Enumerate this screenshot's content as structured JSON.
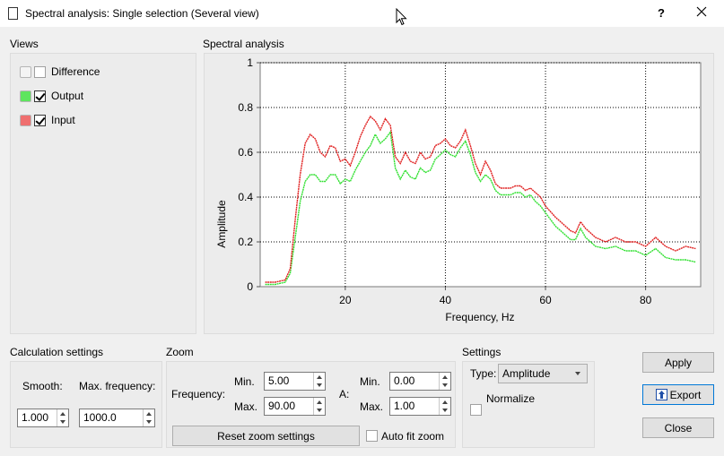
{
  "window": {
    "title": "Spectral analysis: Single selection (Several view)",
    "help": "?",
    "close": "✕"
  },
  "views": {
    "label": "Views",
    "items": [
      {
        "label": "Difference",
        "checked": false,
        "color": "#f4f4f4"
      },
      {
        "label": "Output",
        "checked": true,
        "color": "#5ee55e"
      },
      {
        "label": "Input",
        "checked": true,
        "color": "#ef6f6f"
      }
    ]
  },
  "chart_group_label": "Spectral analysis",
  "chart_data": {
    "type": "line",
    "xlabel": "Frequency, Hz",
    "ylabel": "Amplitude",
    "xlim": [
      3,
      91
    ],
    "ylim": [
      0,
      1
    ],
    "xticks": [
      "20",
      "40",
      "60",
      "80"
    ],
    "yticks": [
      "0",
      "0.2",
      "0.4",
      "0.6",
      "0.8",
      "1"
    ],
    "grid": true,
    "series": [
      {
        "color": "#e02020",
        "x": [
          4,
          6,
          8,
          9,
          10,
          11,
          12,
          13,
          14,
          15,
          16,
          17,
          18,
          19,
          20,
          21,
          22,
          23,
          24,
          25,
          26,
          27,
          28,
          29,
          30,
          31,
          32,
          33,
          34,
          35,
          36,
          37,
          38,
          39,
          40,
          41,
          42,
          43,
          44,
          45,
          46,
          47,
          48,
          49,
          50,
          51,
          52,
          53,
          54,
          55,
          56,
          57,
          58,
          59,
          60,
          62,
          64,
          65,
          66,
          67,
          68,
          70,
          72,
          74,
          76,
          78,
          80,
          82,
          84,
          86,
          88,
          90
        ],
        "values": [
          0.02,
          0.02,
          0.03,
          0.08,
          0.3,
          0.5,
          0.64,
          0.68,
          0.66,
          0.6,
          0.58,
          0.63,
          0.62,
          0.56,
          0.57,
          0.54,
          0.6,
          0.67,
          0.72,
          0.76,
          0.74,
          0.7,
          0.75,
          0.72,
          0.58,
          0.55,
          0.6,
          0.56,
          0.55,
          0.6,
          0.57,
          0.58,
          0.63,
          0.64,
          0.66,
          0.63,
          0.62,
          0.65,
          0.7,
          0.63,
          0.55,
          0.5,
          0.56,
          0.52,
          0.46,
          0.44,
          0.44,
          0.44,
          0.45,
          0.45,
          0.43,
          0.44,
          0.42,
          0.4,
          0.36,
          0.31,
          0.27,
          0.25,
          0.24,
          0.29,
          0.26,
          0.22,
          0.2,
          0.22,
          0.2,
          0.2,
          0.18,
          0.22,
          0.18,
          0.16,
          0.18,
          0.17
        ]
      },
      {
        "color": "#30e030",
        "x": [
          4,
          6,
          8,
          9,
          10,
          11,
          12,
          13,
          14,
          15,
          16,
          17,
          18,
          19,
          20,
          21,
          22,
          23,
          24,
          25,
          26,
          27,
          28,
          29,
          30,
          31,
          32,
          33,
          34,
          35,
          36,
          37,
          38,
          39,
          40,
          41,
          42,
          43,
          44,
          45,
          46,
          47,
          48,
          49,
          50,
          51,
          52,
          53,
          54,
          55,
          56,
          57,
          58,
          59,
          60,
          62,
          64,
          65,
          66,
          67,
          68,
          70,
          72,
          74,
          76,
          78,
          80,
          82,
          84,
          86,
          88,
          90
        ],
        "values": [
          0.01,
          0.01,
          0.02,
          0.06,
          0.22,
          0.38,
          0.47,
          0.5,
          0.5,
          0.47,
          0.47,
          0.5,
          0.5,
          0.46,
          0.48,
          0.47,
          0.52,
          0.56,
          0.6,
          0.63,
          0.68,
          0.64,
          0.66,
          0.69,
          0.53,
          0.48,
          0.52,
          0.49,
          0.48,
          0.53,
          0.51,
          0.52,
          0.57,
          0.59,
          0.61,
          0.59,
          0.58,
          0.62,
          0.65,
          0.59,
          0.51,
          0.47,
          0.5,
          0.48,
          0.43,
          0.41,
          0.41,
          0.41,
          0.42,
          0.42,
          0.4,
          0.41,
          0.38,
          0.36,
          0.33,
          0.27,
          0.23,
          0.21,
          0.21,
          0.26,
          0.22,
          0.18,
          0.17,
          0.18,
          0.16,
          0.16,
          0.14,
          0.17,
          0.13,
          0.12,
          0.12,
          0.11
        ]
      }
    ]
  },
  "calc": {
    "label": "Calculation settings",
    "smooth_label": "Smooth:",
    "maxfreq_label": "Max. frequency:",
    "smooth_value": "1.000",
    "maxfreq_value": "1000.0"
  },
  "zoom": {
    "label": "Zoom",
    "frequency_label": "Frequency:",
    "a_label": "A:",
    "min_label": "Min.",
    "max_label": "Max.",
    "freq_min": "5.00",
    "freq_max": "90.00",
    "a_min": "0.00",
    "a_max": "1.00",
    "reset_label": "Reset zoom settings",
    "autofit_label": "Auto fit zoom"
  },
  "settings": {
    "label": "Settings",
    "type_label": "Type:",
    "type_value": "Amplitude",
    "normalize_label": "Normalize"
  },
  "buttons": {
    "apply": "Apply",
    "export": "Export",
    "close": "Close"
  }
}
